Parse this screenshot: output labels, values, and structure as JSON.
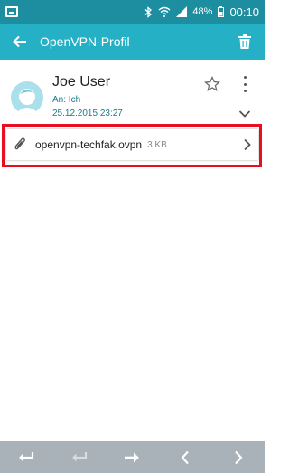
{
  "status_bar": {
    "battery": "48%",
    "time": "00:10"
  },
  "app_bar": {
    "title": "OpenVPN-Profil"
  },
  "message": {
    "sender": "Joe User",
    "recipient": "An: Ich",
    "datetime": "25.12.2015  23:27"
  },
  "attachment": {
    "filename": "openvpn-techfak.ovpn",
    "size": "3 KB"
  },
  "colors": {
    "status_bar": "#1d8ea0",
    "app_bar": "#25b0c6",
    "highlight_frame": "#e8101f",
    "bottom_bar": "#a9b1b9"
  },
  "icons": {
    "back": "arrow-left-icon",
    "delete": "trash-icon",
    "star": "star-outline-icon",
    "more": "more-vert-icon",
    "expand": "chevron-down-icon",
    "attachment": "paperclip-icon",
    "open": "chevron-right-icon",
    "bottom": [
      "reply-icon",
      "reply-all-icon",
      "forward-icon",
      "previous-icon",
      "next-icon"
    ]
  }
}
